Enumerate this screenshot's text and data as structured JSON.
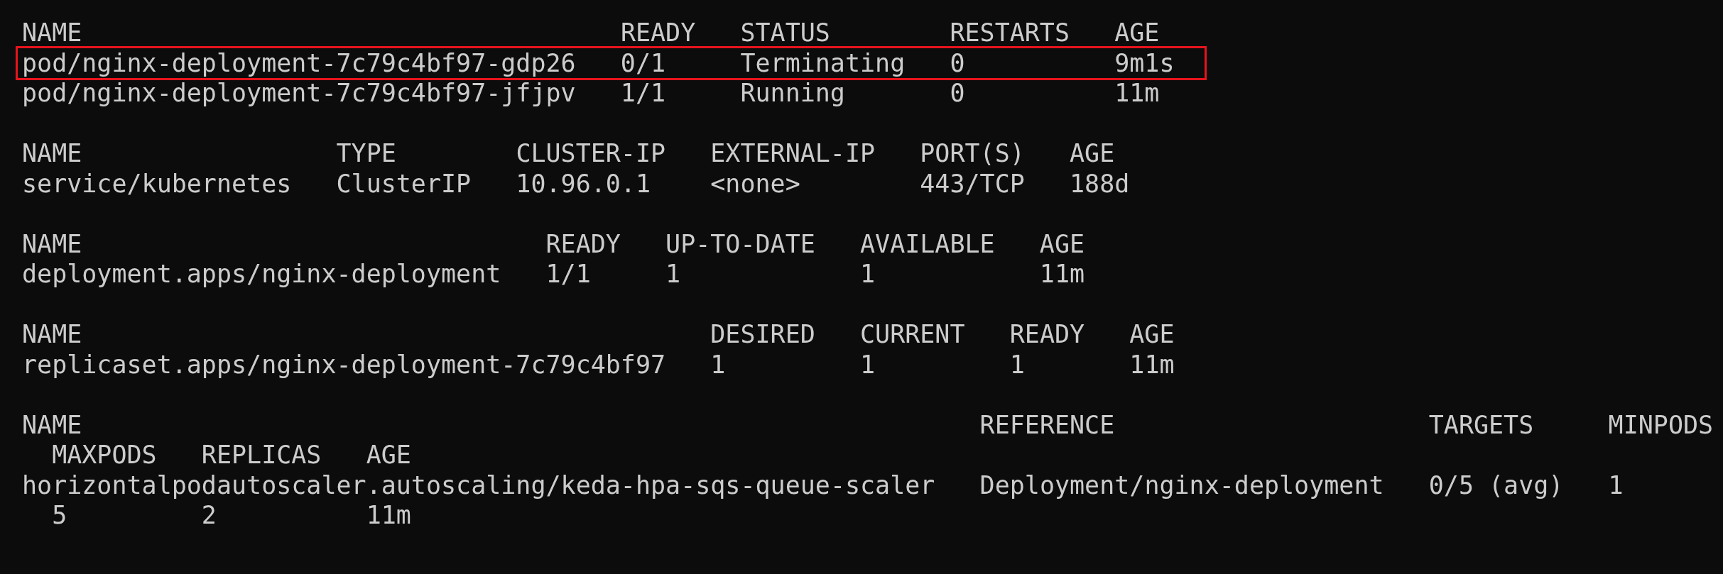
{
  "tables": [
    {
      "columns": [
        "NAME",
        "READY",
        "STATUS",
        "RESTARTS",
        "AGE"
      ],
      "rows": [
        {
          "cells": [
            "pod/nginx-deployment-7c79c4bf97-gdp26",
            "0/1",
            "Terminating",
            "0",
            "9m1s"
          ],
          "highlighted": true
        },
        {
          "cells": [
            "pod/nginx-deployment-7c79c4bf97-jfjpv",
            "1/1",
            "Running",
            "0",
            "11m"
          ],
          "highlighted": false
        }
      ]
    },
    {
      "columns": [
        "NAME",
        "TYPE",
        "CLUSTER-IP",
        "EXTERNAL-IP",
        "PORT(S)",
        "AGE"
      ],
      "rows": [
        {
          "cells": [
            "service/kubernetes",
            "ClusterIP",
            "10.96.0.1",
            "<none>",
            "443/TCP",
            "188d"
          ],
          "highlighted": false
        }
      ]
    },
    {
      "columns": [
        "NAME",
        "READY",
        "UP-TO-DATE",
        "AVAILABLE",
        "AGE"
      ],
      "rows": [
        {
          "cells": [
            "deployment.apps/nginx-deployment",
            "1/1",
            "1",
            "1",
            "11m"
          ],
          "highlighted": false
        }
      ]
    },
    {
      "columns": [
        "NAME",
        "DESIRED",
        "CURRENT",
        "READY",
        "AGE"
      ],
      "rows": [
        {
          "cells": [
            "replicaset.apps/nginx-deployment-7c79c4bf97",
            "1",
            "1",
            "1",
            "11m"
          ],
          "highlighted": false
        }
      ]
    },
    {
      "columns": [
        "NAME",
        "REFERENCE",
        "TARGETS",
        "MINPODS",
        "MAXPODS",
        "REPLICAS",
        "AGE"
      ],
      "rows": [
        {
          "cells": [
            "horizontalpodautoscaler.autoscaling/keda-hpa-sqs-queue-scaler",
            "Deployment/nginx-deployment",
            "0/5 (avg)",
            "1",
            "5",
            "2",
            "11m"
          ],
          "highlighted": false
        }
      ]
    }
  ]
}
